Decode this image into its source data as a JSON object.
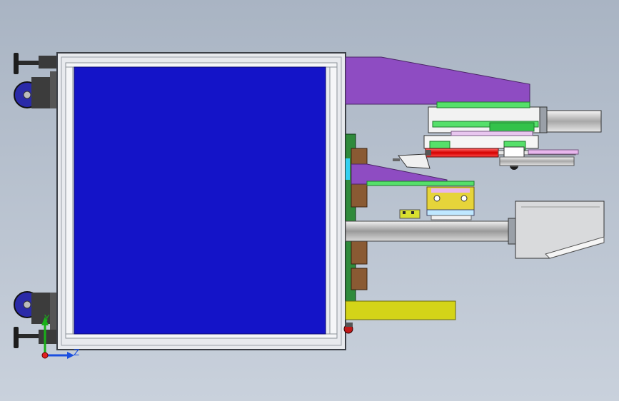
{
  "viewport": {
    "background_top": "#a9b4c3",
    "background_bottom": "#c9d1dc"
  },
  "colors": {
    "frame": "#e8eaee",
    "frame_edge": "#3b3f46",
    "panel": "#1414c8",
    "purple": "#8e4cc2",
    "green": "#55e06a",
    "red": "#e01010",
    "yellow": "#d4d418",
    "brown": "#8a5a33",
    "gray_metal": "#c7c9cc",
    "wheel": "#2a2aa8"
  },
  "triad": {
    "y_label": "Y",
    "z_label": "Z",
    "y_color": "#19b019",
    "z_color": "#1a4fe0",
    "origin_color": "#e02020"
  }
}
